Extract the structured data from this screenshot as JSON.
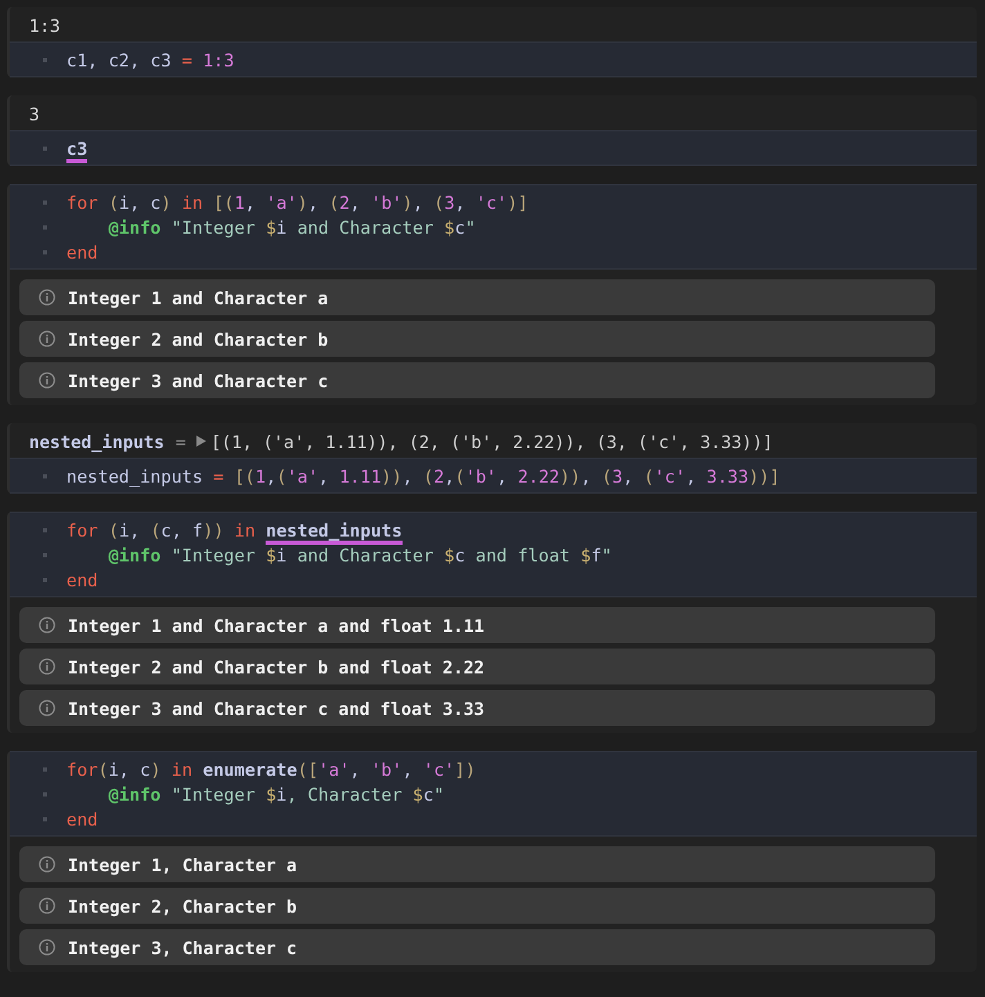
{
  "cells": [
    {
      "output": {
        "kind": "text",
        "text": "1:3"
      },
      "code": [
        [
          {
            "kind": "var",
            "text": "c1, c2, c3 "
          },
          {
            "kind": "op",
            "text": "= "
          },
          {
            "kind": "num",
            "text": "1:3"
          }
        ]
      ]
    },
    {
      "output": {
        "kind": "text",
        "text": "3"
      },
      "code": [
        [
          {
            "kind": "ref",
            "text": "c3"
          }
        ]
      ]
    },
    {
      "code": [
        [
          {
            "kind": "kw",
            "text": "for "
          },
          {
            "kind": "paren",
            "text": "("
          },
          {
            "kind": "var",
            "text": "i, c"
          },
          {
            "kind": "paren",
            "text": ") "
          },
          {
            "kind": "kw",
            "text": "in "
          },
          {
            "kind": "paren",
            "text": "[("
          },
          {
            "kind": "num",
            "text": "1"
          },
          {
            "kind": "var",
            "text": ", "
          },
          {
            "kind": "num",
            "text": "'a'"
          },
          {
            "kind": "paren",
            "text": ")"
          },
          {
            "kind": "var",
            "text": ", "
          },
          {
            "kind": "paren",
            "text": "("
          },
          {
            "kind": "num",
            "text": "2"
          },
          {
            "kind": "var",
            "text": ", "
          },
          {
            "kind": "num",
            "text": "'b'"
          },
          {
            "kind": "paren",
            "text": ")"
          },
          {
            "kind": "var",
            "text": ", "
          },
          {
            "kind": "paren",
            "text": "("
          },
          {
            "kind": "num",
            "text": "3"
          },
          {
            "kind": "var",
            "text": ", "
          },
          {
            "kind": "num",
            "text": "'c'"
          },
          {
            "kind": "paren",
            "text": ")]"
          }
        ],
        [
          {
            "kind": "macro",
            "text": "    @info "
          },
          {
            "kind": "str",
            "text": "\"Integer "
          },
          {
            "kind": "dollar",
            "text": "$"
          },
          {
            "kind": "var",
            "text": "i"
          },
          {
            "kind": "str",
            "text": " and Character "
          },
          {
            "kind": "dollar",
            "text": "$"
          },
          {
            "kind": "var",
            "text": "c"
          },
          {
            "kind": "str",
            "text": "\""
          }
        ],
        [
          {
            "kind": "kw",
            "text": "end"
          }
        ]
      ],
      "logs": [
        {
          "text": "Integer 1 and Character a"
        },
        {
          "text": "Integer 2 and Character b"
        },
        {
          "text": "Integer 3 and Character c"
        }
      ]
    },
    {
      "output": {
        "kind": "tree",
        "name": "nested_inputs",
        "sep": "=",
        "value": "[(1, ('a', 1.11)), (2, ('b', 2.22)), (3, ('c', 3.33))]",
        "expanded": false
      },
      "code": [
        [
          {
            "kind": "var",
            "text": "nested_inputs "
          },
          {
            "kind": "op",
            "text": "= "
          },
          {
            "kind": "paren",
            "text": "[("
          },
          {
            "kind": "num",
            "text": "1"
          },
          {
            "kind": "var",
            "text": ","
          },
          {
            "kind": "paren",
            "text": "("
          },
          {
            "kind": "num",
            "text": "'a'"
          },
          {
            "kind": "var",
            "text": ", "
          },
          {
            "kind": "num",
            "text": "1.11"
          },
          {
            "kind": "paren",
            "text": "))"
          },
          {
            "kind": "var",
            "text": ", "
          },
          {
            "kind": "paren",
            "text": "("
          },
          {
            "kind": "num",
            "text": "2"
          },
          {
            "kind": "var",
            "text": ","
          },
          {
            "kind": "paren",
            "text": "("
          },
          {
            "kind": "num",
            "text": "'b'"
          },
          {
            "kind": "var",
            "text": ", "
          },
          {
            "kind": "num",
            "text": "2.22"
          },
          {
            "kind": "paren",
            "text": "))"
          },
          {
            "kind": "var",
            "text": ", "
          },
          {
            "kind": "paren",
            "text": "("
          },
          {
            "kind": "num",
            "text": "3"
          },
          {
            "kind": "var",
            "text": ", "
          },
          {
            "kind": "paren",
            "text": "("
          },
          {
            "kind": "num",
            "text": "'c'"
          },
          {
            "kind": "var",
            "text": ", "
          },
          {
            "kind": "num",
            "text": "3.33"
          },
          {
            "kind": "paren",
            "text": "))]"
          }
        ]
      ]
    },
    {
      "code": [
        [
          {
            "kind": "kw",
            "text": "for "
          },
          {
            "kind": "paren",
            "text": "("
          },
          {
            "kind": "var",
            "text": "i, "
          },
          {
            "kind": "paren",
            "text": "("
          },
          {
            "kind": "var",
            "text": "c, f"
          },
          {
            "kind": "paren",
            "text": ")) "
          },
          {
            "kind": "kw",
            "text": "in "
          },
          {
            "kind": "ref",
            "text": "nested_inputs"
          }
        ],
        [
          {
            "kind": "macro",
            "text": "    @info "
          },
          {
            "kind": "str",
            "text": "\"Integer "
          },
          {
            "kind": "dollar",
            "text": "$"
          },
          {
            "kind": "var",
            "text": "i"
          },
          {
            "kind": "str",
            "text": " and Character "
          },
          {
            "kind": "dollar",
            "text": "$"
          },
          {
            "kind": "var",
            "text": "c"
          },
          {
            "kind": "str",
            "text": " and float "
          },
          {
            "kind": "dollar",
            "text": "$"
          },
          {
            "kind": "var",
            "text": "f"
          },
          {
            "kind": "str",
            "text": "\""
          }
        ],
        [
          {
            "kind": "kw",
            "text": "end"
          }
        ]
      ],
      "logs": [
        {
          "text": "Integer 1 and Character a and float 1.11"
        },
        {
          "text": "Integer 2 and Character b and float 2.22"
        },
        {
          "text": "Integer 3 and Character c and float 3.33"
        }
      ]
    },
    {
      "code": [
        [
          {
            "kind": "kw",
            "text": "for"
          },
          {
            "kind": "paren",
            "text": "("
          },
          {
            "kind": "var",
            "text": "i, c"
          },
          {
            "kind": "paren",
            "text": ") "
          },
          {
            "kind": "kw",
            "text": "in "
          },
          {
            "kind": "fn",
            "text": "enumerate"
          },
          {
            "kind": "paren",
            "text": "(["
          },
          {
            "kind": "num",
            "text": "'a'"
          },
          {
            "kind": "var",
            "text": ", "
          },
          {
            "kind": "num",
            "text": "'b'"
          },
          {
            "kind": "var",
            "text": ", "
          },
          {
            "kind": "num",
            "text": "'c'"
          },
          {
            "kind": "paren",
            "text": "])"
          }
        ],
        [
          {
            "kind": "macro",
            "text": "    @info "
          },
          {
            "kind": "str",
            "text": "\"Integer "
          },
          {
            "kind": "dollar",
            "text": "$"
          },
          {
            "kind": "var",
            "text": "i"
          },
          {
            "kind": "str",
            "text": ", Character "
          },
          {
            "kind": "dollar",
            "text": "$"
          },
          {
            "kind": "var",
            "text": "c"
          },
          {
            "kind": "str",
            "text": "\""
          }
        ],
        [
          {
            "kind": "kw",
            "text": "end"
          }
        ]
      ],
      "logs": [
        {
          "text": "Integer 1, Character a"
        },
        {
          "text": "Integer 2, Character b"
        },
        {
          "text": "Integer 3, Character c"
        }
      ]
    }
  ]
}
